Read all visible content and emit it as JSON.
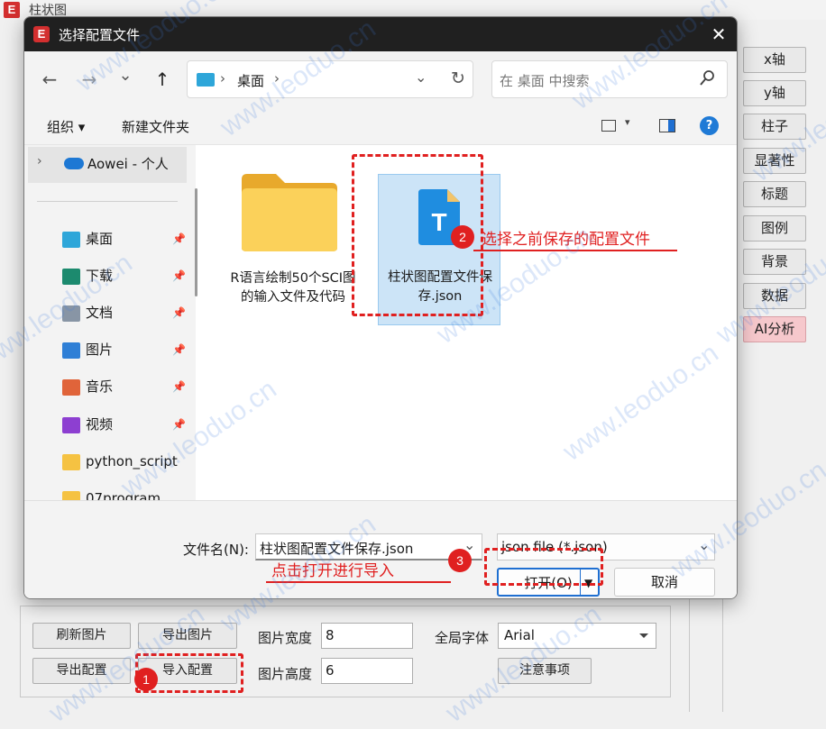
{
  "app": {
    "logo": "E",
    "title": "柱状图",
    "right_buttons": [
      "x轴",
      "y轴",
      "柱子",
      "显著性",
      "标题",
      "图例",
      "背景",
      "数据",
      "AI分析"
    ],
    "bottom": {
      "refresh_image": "刷新图片",
      "export_image": "导出图片",
      "export_config": "导出配置",
      "import_config": "导入配置",
      "image_width_label": "图片宽度",
      "image_width_value": "8",
      "image_height_label": "图片高度",
      "image_height_value": "6",
      "global_font_label": "全局字体",
      "global_font_value": "Arial",
      "notes_button": "注意事项"
    }
  },
  "dialog": {
    "title": "选择配置文件",
    "nav": {
      "back": "←",
      "forward": "→",
      "recent": "⌄",
      "up": "↑",
      "breadcrumb_location": "桌面",
      "breadcrumb_sep": "›",
      "refresh": "↻",
      "search_placeholder": "在 桌面 中搜索"
    },
    "commands": {
      "organize": "组织 ▾",
      "new_folder": "新建文件夹"
    },
    "sidebar": {
      "cloud": "Aowei - 个人",
      "items": [
        {
          "label": "桌面",
          "icon": "desktop-icon",
          "color": "#2ea6d9"
        },
        {
          "label": "下载",
          "icon": "download-icon",
          "color": "#1c8a6e"
        },
        {
          "label": "文档",
          "icon": "document-icon",
          "color": "#8895a5"
        },
        {
          "label": "图片",
          "icon": "pictures-icon",
          "color": "#2f7fd6"
        },
        {
          "label": "音乐",
          "icon": "music-icon",
          "color": "#e0643a"
        },
        {
          "label": "视频",
          "icon": "video-icon",
          "color": "#8d3fd1"
        },
        {
          "label": "python_script",
          "icon": "folder-icon",
          "color": "#f5c242"
        },
        {
          "label": "07program",
          "icon": "folder-icon",
          "color": "#f5c242"
        }
      ]
    },
    "files": [
      {
        "name": "R语言绘制50个SCI图的输入文件及代码",
        "type": "folder"
      },
      {
        "name": "柱状图配置文件保存.json",
        "type": "json",
        "selected": true
      }
    ],
    "footer": {
      "filename_label": "文件名(N):",
      "filename_value": "柱状图配置文件保存.json",
      "filetype_value": "json file (*.json)",
      "open_button": "打开(O)",
      "cancel_button": "取消"
    }
  },
  "annotations": {
    "step1": "1",
    "step2": "2",
    "step2_text": "选择之前保存的配置文件",
    "step3": "3",
    "step3_text": "点击打开进行导入"
  },
  "watermark": "www.leoduo.cn",
  "colors": {
    "annotation_red": "#e02020",
    "ai_button": "#f6c8cc",
    "selection_blue": "#cce4f7",
    "dialog_titlebar": "#202020"
  }
}
